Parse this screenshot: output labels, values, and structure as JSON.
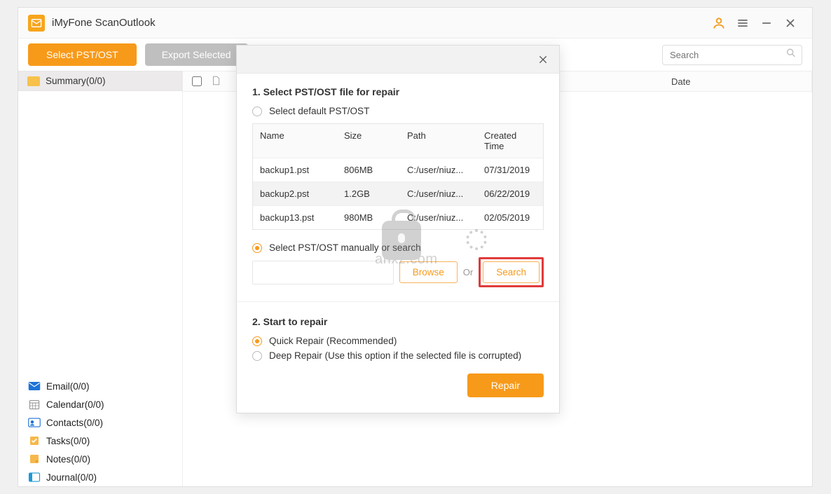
{
  "titlebar": {
    "title": "iMyFone ScanOutlook"
  },
  "toolbar": {
    "select_btn": "Select PST/OST",
    "export_btn": "Export Selected",
    "search_placeholder": "Search"
  },
  "tree": {
    "summary": "Summary(0/0)"
  },
  "listhead": {
    "date": "Date"
  },
  "nav": {
    "email": "Email(0/0)",
    "calendar": "Calendar(0/0)",
    "contacts": "Contacts(0/0)",
    "tasks": "Tasks(0/0)",
    "notes": "Notes(0/0)",
    "journal": "Journal(0/0)"
  },
  "modal": {
    "sec1_title": "1. Select PST/OST file for repair",
    "radio_default": "Select default PST/OST",
    "cols": {
      "name": "Name",
      "size": "Size",
      "path": "Path",
      "time": "Created Time"
    },
    "rows": [
      {
        "name": "backup1.pst",
        "size": "806MB",
        "path": "C:/user/niuz...",
        "time": "07/31/2019"
      },
      {
        "name": "backup2.pst",
        "size": "1.2GB",
        "path": "C:/user/niuz...",
        "time": "06/22/2019"
      },
      {
        "name": "backup13.pst",
        "size": "980MB",
        "path": "C:/user/niuz...",
        "time": "02/05/2019"
      }
    ],
    "radio_manual": "Select PST/OST manually or search",
    "browse": "Browse",
    "or": "Or",
    "search": "Search",
    "sec2_title": "2. Start to repair",
    "quick": "Quick Repair (Recommended)",
    "deep": "Deep Repair (Use this option if the selected file is corrupted)",
    "repair": "Repair"
  },
  "watermark": "anxz.com"
}
